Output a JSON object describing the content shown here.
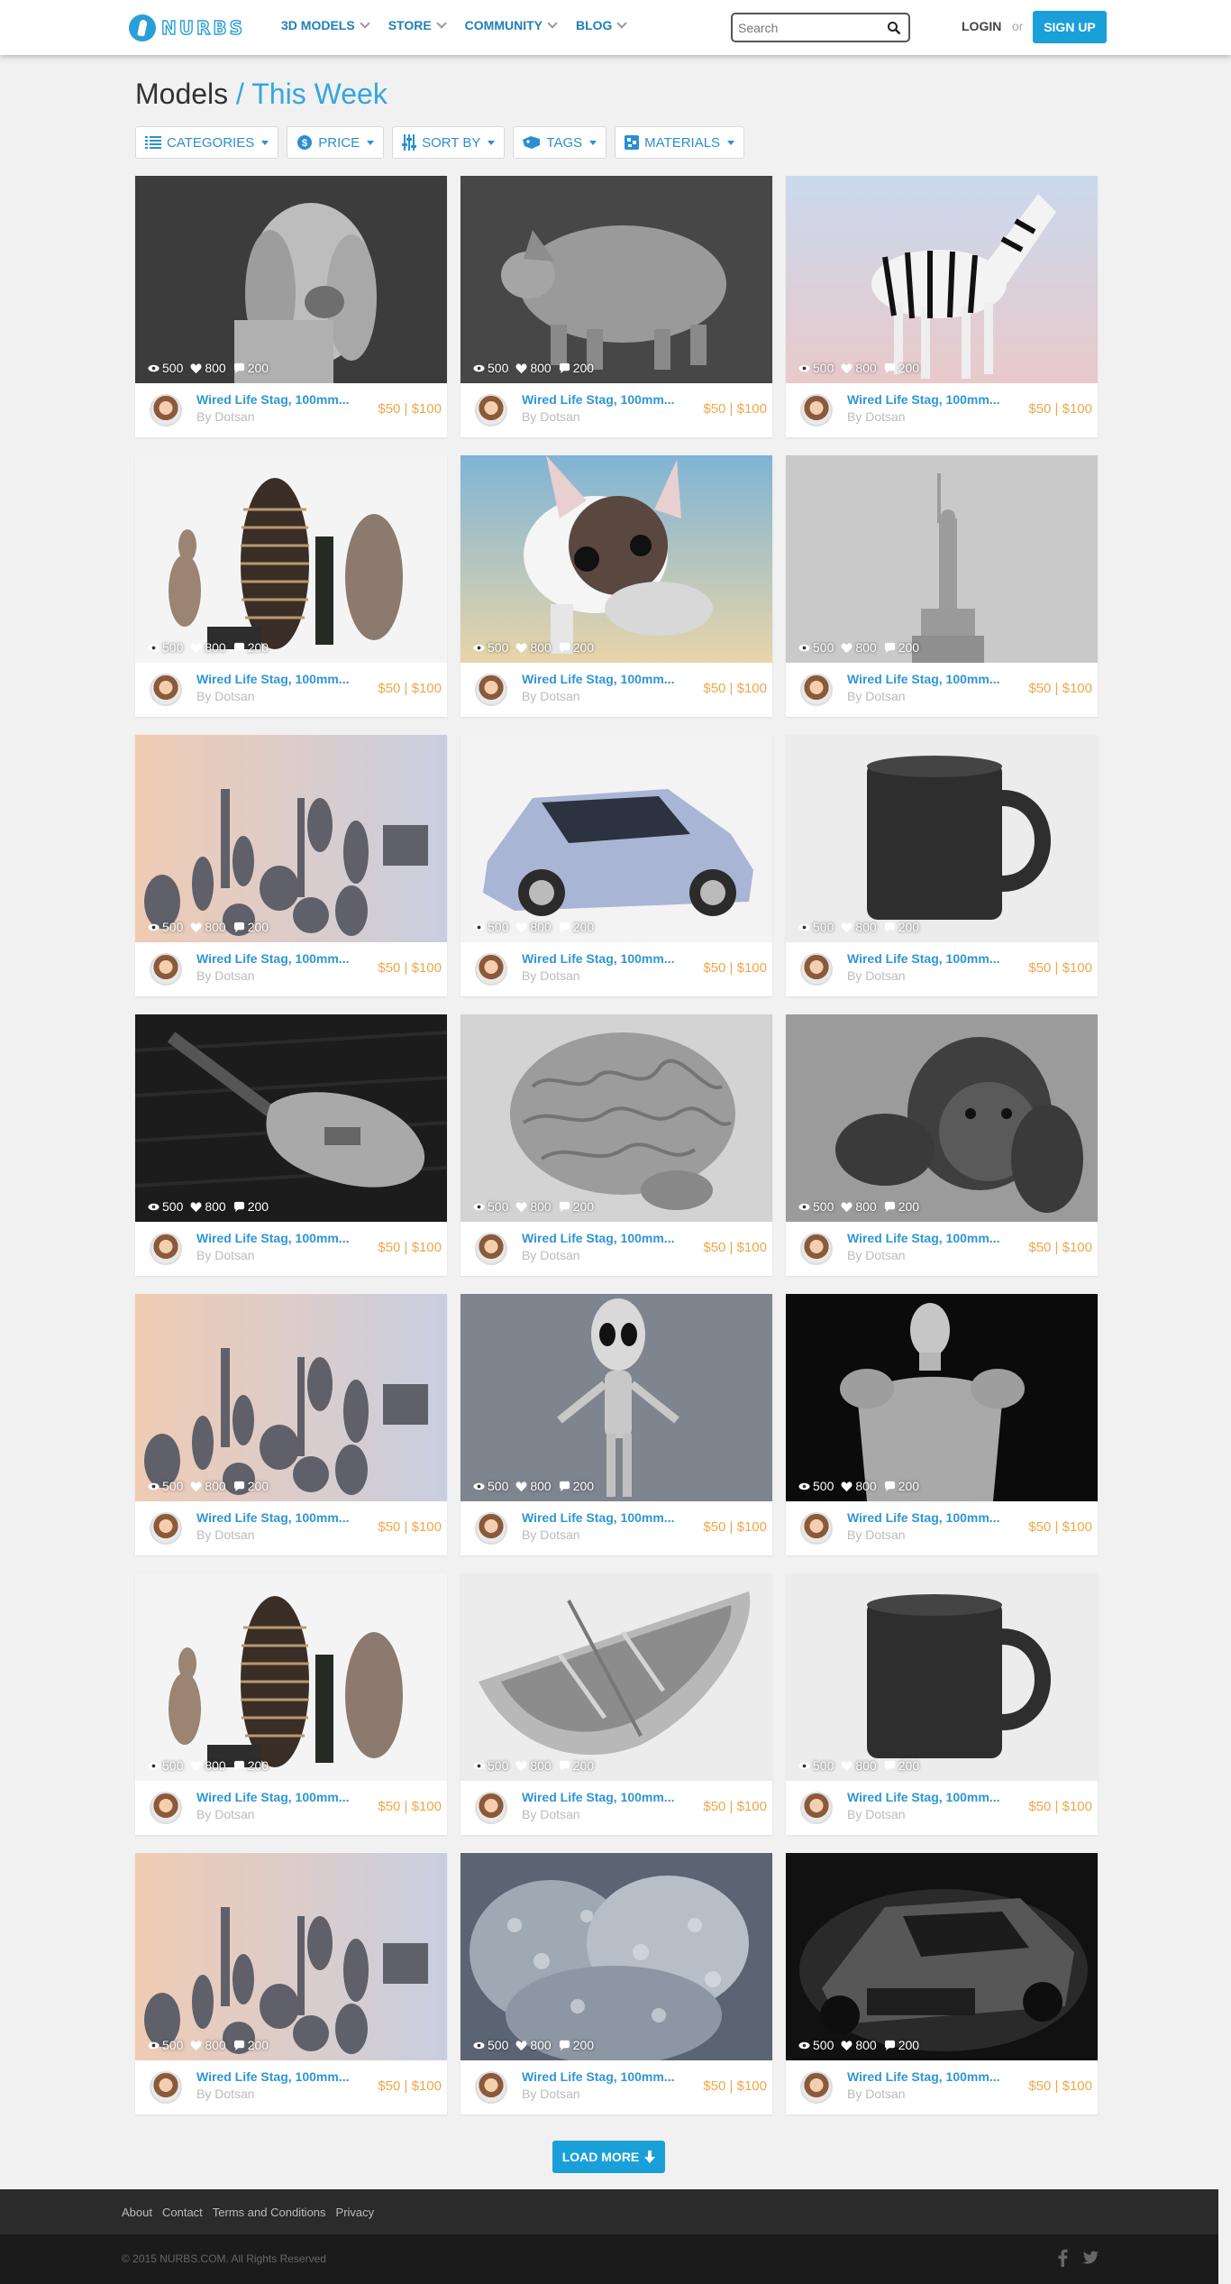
{
  "header": {
    "logo_text": "NURBS",
    "nav": [
      {
        "label": "3D MODELS"
      },
      {
        "label": "STORE"
      },
      {
        "label": "COMMUNITY"
      },
      {
        "label": "BLOG"
      }
    ],
    "search_placeholder": "Search",
    "login": "LOGIN",
    "or": "or",
    "signup": "SIGN UP"
  },
  "title": {
    "main": "Models",
    "sub": "/ This Week"
  },
  "filters": [
    {
      "label": "CATEGORIES",
      "icon": "list-icon"
    },
    {
      "label": "PRICE",
      "icon": "coin-icon"
    },
    {
      "label": "SORT BY",
      "icon": "sliders-icon"
    },
    {
      "label": "TAGS",
      "icon": "tag-icon"
    },
    {
      "label": "MATERIALS",
      "icon": "cubes-icon"
    }
  ],
  "card_defaults": {
    "title": "Wired Life Stag, 100mm...",
    "author": "By Dotsan",
    "price": "$50 | $100",
    "views": "500",
    "likes": "800",
    "comments": "200"
  },
  "cards": [
    {
      "subject": "basset hound bust"
    },
    {
      "subject": "pig"
    },
    {
      "subject": "zebra"
    },
    {
      "subject": "vases trio"
    },
    {
      "subject": "french bulldog"
    },
    {
      "subject": "statue of liberty"
    },
    {
      "subject": "vases collection"
    },
    {
      "subject": "blue sedan"
    },
    {
      "subject": "mug"
    },
    {
      "subject": "electric guitar"
    },
    {
      "subject": "brain"
    },
    {
      "subject": "gorilla bust"
    },
    {
      "subject": "vases collection"
    },
    {
      "subject": "alien"
    },
    {
      "subject": "male torso"
    },
    {
      "subject": "vases trio"
    },
    {
      "subject": "rowing boat"
    },
    {
      "subject": "mug"
    },
    {
      "subject": "vases collection"
    },
    {
      "subject": "coral"
    },
    {
      "subject": "sports car"
    }
  ],
  "load_more": "LOAD MORE",
  "footer": {
    "links": [
      "About",
      "Contact",
      "Terms and Conditions",
      "Privacy"
    ],
    "copyright": "© 2015 NURBS.COM. All Rights Reserved"
  },
  "colors": {
    "accent": "#1aa0d9",
    "price": "#f0a64a",
    "star": "#f5d000"
  }
}
